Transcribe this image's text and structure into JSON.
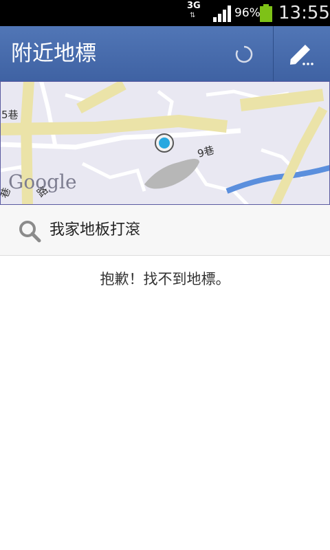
{
  "status_bar": {
    "network": "3G",
    "battery_percent": "96%",
    "time": "13:55",
    "signal_icon": "signal-bars-icon",
    "battery_icon": "battery-icon"
  },
  "action_bar": {
    "title": "附近地標",
    "loading_icon": "spinner-icon",
    "edit_icon": "pencil-icon",
    "color": "#4a6fb1"
  },
  "map": {
    "labels": {
      "lane_left": "5巷",
      "lane_right": "9巷",
      "lane_bottom": "巷",
      "road": "路",
      "google": "Google"
    },
    "marker_icon": "location-marker-icon"
  },
  "search": {
    "query": "我家地板打滾",
    "icon": "search-icon"
  },
  "results": {
    "empty_message": "抱歉！找不到地標。"
  }
}
